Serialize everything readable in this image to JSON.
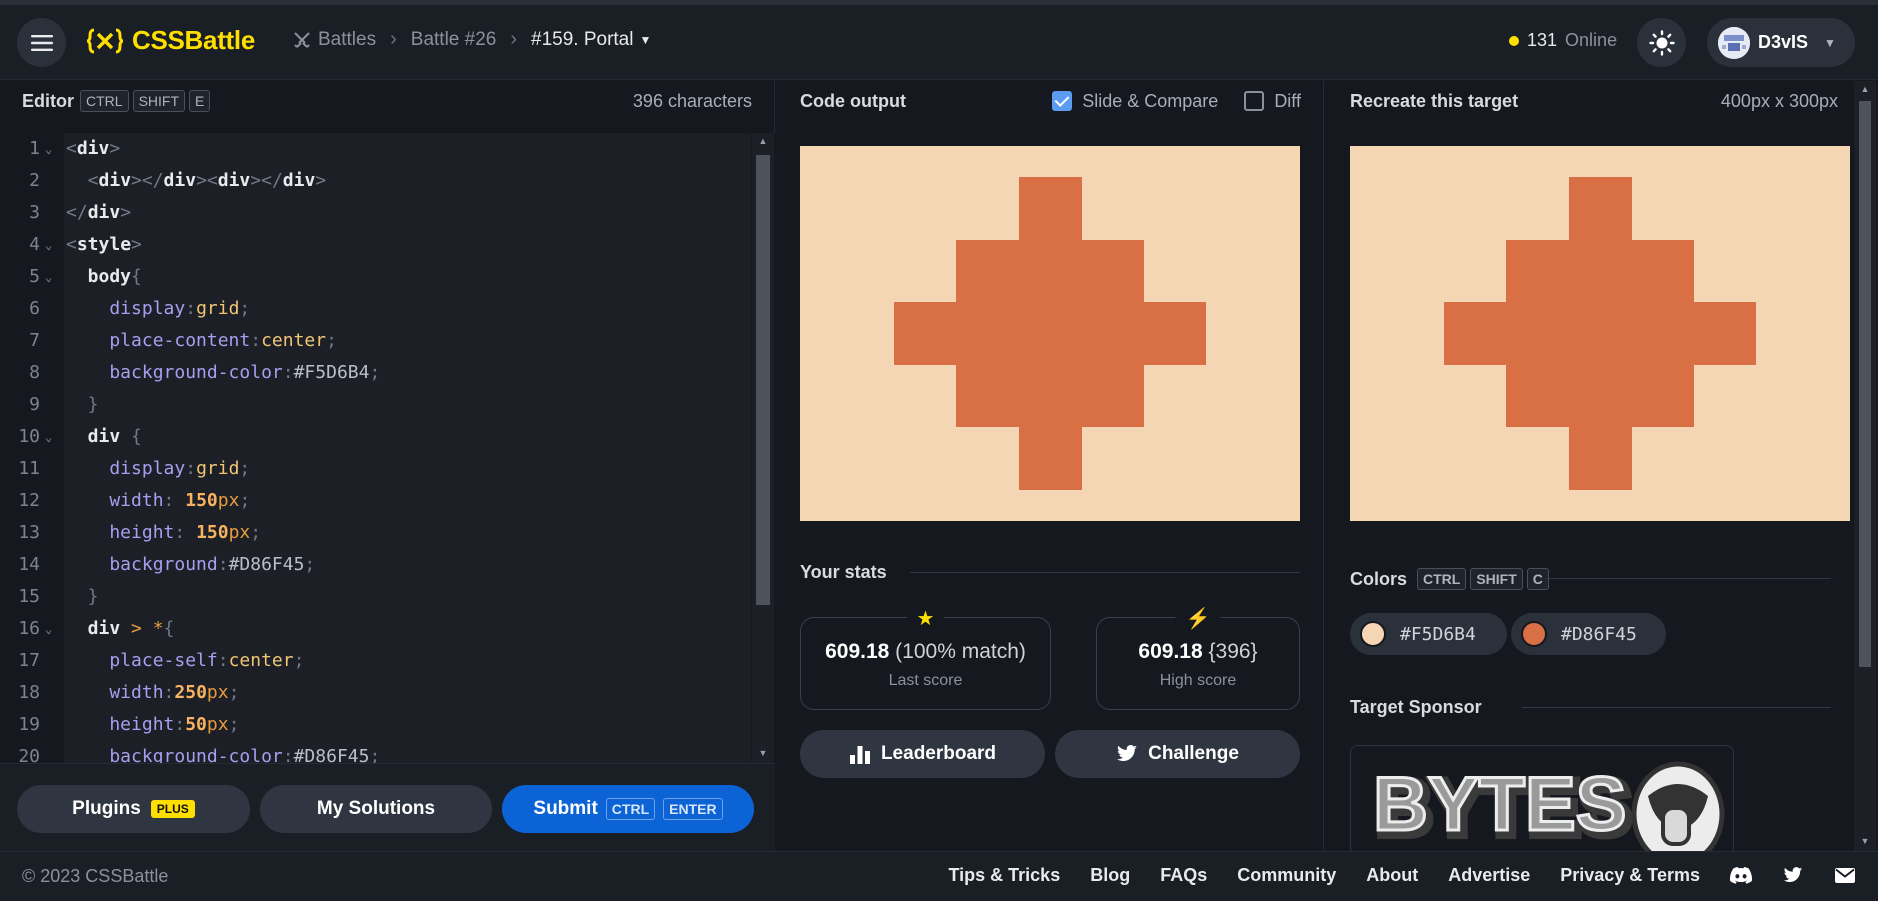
{
  "header": {
    "logo_text": "CSSBattle",
    "breadcrumbs": [
      "Battles",
      "Battle #26",
      "#159. Portal"
    ],
    "online_count": "131",
    "online_label": "Online",
    "user_name": "D3vIS"
  },
  "editor": {
    "title": "Editor",
    "shortcut": [
      "CTRL",
      "SHIFT",
      "E"
    ],
    "char_count": "396 characters",
    "lines": [
      {
        "n": "1",
        "fold": true,
        "tokens": [
          [
            "t-punc",
            "<"
          ],
          [
            "t-tag",
            "div"
          ],
          [
            "t-punc",
            ">"
          ]
        ]
      },
      {
        "n": "2",
        "fold": false,
        "tokens": [
          [
            "t-punc",
            "  <"
          ],
          [
            "t-tag",
            "div"
          ],
          [
            "t-punc",
            "></"
          ],
          [
            "t-tag",
            "div"
          ],
          [
            "t-punc",
            "><"
          ],
          [
            "t-tag",
            "div"
          ],
          [
            "t-punc",
            "></"
          ],
          [
            "t-tag",
            "div"
          ],
          [
            "t-punc",
            ">"
          ]
        ]
      },
      {
        "n": "3",
        "fold": false,
        "tokens": [
          [
            "t-punc",
            "</"
          ],
          [
            "t-tag",
            "div"
          ],
          [
            "t-punc",
            ">"
          ]
        ]
      },
      {
        "n": "4",
        "fold": true,
        "tokens": [
          [
            "t-punc",
            "<"
          ],
          [
            "t-tag",
            "style"
          ],
          [
            "t-punc",
            ">"
          ]
        ]
      },
      {
        "n": "5",
        "fold": true,
        "tokens": [
          [
            "t-sel",
            "  body"
          ],
          [
            "t-punc",
            "{"
          ]
        ]
      },
      {
        "n": "6",
        "fold": false,
        "tokens": [
          [
            "t-prop",
            "    display"
          ],
          [
            "t-punc",
            ":"
          ],
          [
            "t-val",
            "grid"
          ],
          [
            "t-punc",
            ";"
          ]
        ]
      },
      {
        "n": "7",
        "fold": false,
        "tokens": [
          [
            "t-prop",
            "    place-content"
          ],
          [
            "t-punc",
            ":"
          ],
          [
            "t-val",
            "center"
          ],
          [
            "t-punc",
            ";"
          ]
        ]
      },
      {
        "n": "8",
        "fold": false,
        "tokens": [
          [
            "t-prop",
            "    background-color"
          ],
          [
            "t-punc",
            ":"
          ],
          [
            "t-hex",
            "#F5D6B4"
          ],
          [
            "t-punc",
            ";"
          ]
        ]
      },
      {
        "n": "9",
        "fold": false,
        "tokens": [
          [
            "t-punc",
            "  }"
          ]
        ]
      },
      {
        "n": "10",
        "fold": true,
        "tokens": [
          [
            "t-sel",
            "  div "
          ],
          [
            "t-punc",
            "{"
          ]
        ]
      },
      {
        "n": "11",
        "fold": false,
        "tokens": [
          [
            "t-prop",
            "    display"
          ],
          [
            "t-punc",
            ":"
          ],
          [
            "t-val",
            "grid"
          ],
          [
            "t-punc",
            ";"
          ]
        ]
      },
      {
        "n": "12",
        "fold": false,
        "tokens": [
          [
            "t-prop",
            "    width"
          ],
          [
            "t-punc",
            ": "
          ],
          [
            "t-num",
            "150"
          ],
          [
            "t-unit",
            "px"
          ],
          [
            "t-punc",
            ";"
          ]
        ]
      },
      {
        "n": "13",
        "fold": false,
        "tokens": [
          [
            "t-prop",
            "    height"
          ],
          [
            "t-punc",
            ": "
          ],
          [
            "t-num",
            "150"
          ],
          [
            "t-unit",
            "px"
          ],
          [
            "t-punc",
            ";"
          ]
        ]
      },
      {
        "n": "14",
        "fold": false,
        "tokens": [
          [
            "t-prop",
            "    background"
          ],
          [
            "t-punc",
            ":"
          ],
          [
            "t-hex",
            "#D86F45"
          ],
          [
            "t-punc",
            ";"
          ]
        ]
      },
      {
        "n": "15",
        "fold": false,
        "tokens": [
          [
            "t-punc",
            "  }"
          ]
        ]
      },
      {
        "n": "16",
        "fold": true,
        "tokens": [
          [
            "t-sel",
            "  div "
          ],
          [
            "t-unit",
            "> *"
          ],
          [
            "t-punc",
            "{"
          ]
        ]
      },
      {
        "n": "17",
        "fold": false,
        "tokens": [
          [
            "t-prop",
            "    place-self"
          ],
          [
            "t-punc",
            ":"
          ],
          [
            "t-val",
            "center"
          ],
          [
            "t-punc",
            ";"
          ]
        ]
      },
      {
        "n": "18",
        "fold": false,
        "tokens": [
          [
            "t-prop",
            "    width"
          ],
          [
            "t-punc",
            ":"
          ],
          [
            "t-num",
            "250"
          ],
          [
            "t-unit",
            "px"
          ],
          [
            "t-punc",
            ";"
          ]
        ]
      },
      {
        "n": "19",
        "fold": false,
        "tokens": [
          [
            "t-prop",
            "    height"
          ],
          [
            "t-punc",
            ":"
          ],
          [
            "t-num",
            "50"
          ],
          [
            "t-unit",
            "px"
          ],
          [
            "t-punc",
            ";"
          ]
        ]
      },
      {
        "n": "20",
        "fold": false,
        "tokens": [
          [
            "t-prop",
            "    background-color"
          ],
          [
            "t-punc",
            ":"
          ],
          [
            "t-hex",
            "#D86F45"
          ],
          [
            "t-punc",
            ";"
          ]
        ]
      }
    ],
    "buttons": {
      "plugins": "Plugins",
      "plugins_badge": "PLUS",
      "solutions": "My Solutions",
      "submit": "Submit",
      "submit_keys": [
        "CTRL",
        "ENTER"
      ]
    }
  },
  "output": {
    "title": "Code output",
    "slide_compare": "Slide & Compare",
    "diff": "Diff",
    "stats_title": "Your stats",
    "last_score": {
      "value": "609.18",
      "detail": "(100% match)",
      "label": "Last score"
    },
    "high_score": {
      "value": "609.18",
      "detail": "{396}",
      "label": "High score"
    },
    "leaderboard": "Leaderboard",
    "challenge": "Challenge"
  },
  "target": {
    "title": "Recreate this target",
    "size": "400px x 300px",
    "colors_title": "Colors",
    "colors_shortcut": [
      "CTRL",
      "SHIFT",
      "C"
    ],
    "colors": [
      "#F5D6B4",
      "#D86F45"
    ],
    "sponsor_title": "Target Sponsor",
    "sponsor_text": "BYTES"
  },
  "footer": {
    "copyright": "© 2023 CSSBattle",
    "links": [
      "Tips & Tricks",
      "Blog",
      "FAQs",
      "Community",
      "About",
      "Advertise",
      "Privacy & Terms"
    ]
  }
}
